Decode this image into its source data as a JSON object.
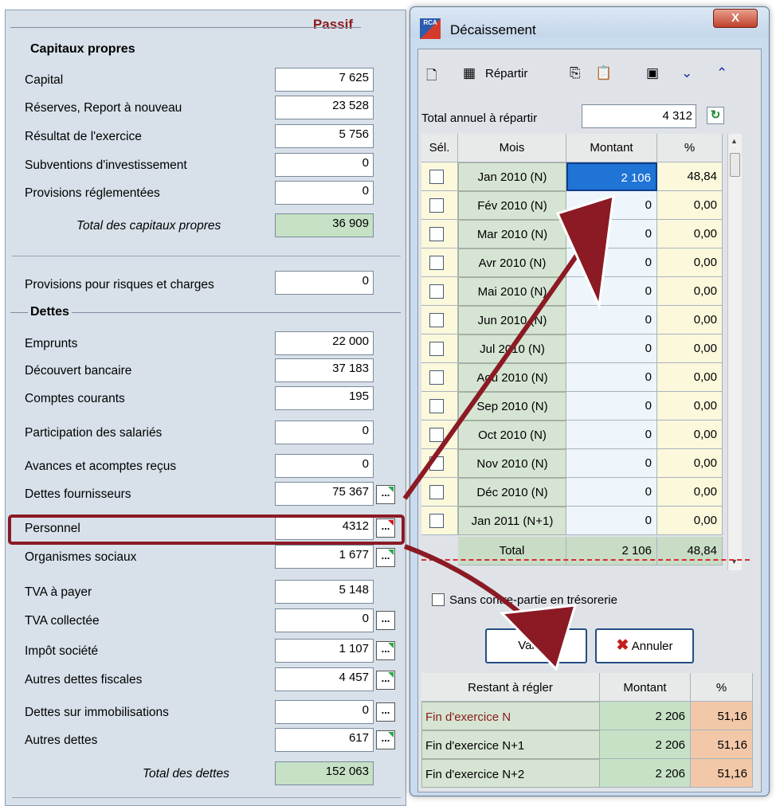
{
  "passif": {
    "title": "Passif",
    "capitaux_label": "Capitaux propres",
    "capitaux": [
      {
        "label": "Capital",
        "value": "7 625"
      },
      {
        "label": "Réserves, Report à nouveau",
        "value": "23 528"
      },
      {
        "label": "Résultat de l'exercice",
        "value": "5 756"
      },
      {
        "label": "Subventions d'investissement",
        "value": "0"
      },
      {
        "label": "Provisions réglementées",
        "value": "0"
      }
    ],
    "total_capitaux": {
      "label": "Total des capitaux propres",
      "value": "36 909"
    },
    "provisions": {
      "label": "Provisions pour risques et charges",
      "value": "0"
    },
    "dettes_label": "Dettes",
    "dettes": [
      {
        "label": "Emprunts",
        "value": "22 000"
      },
      {
        "label": "Découvert bancaire",
        "value": "37 183"
      },
      {
        "label": "Comptes courants",
        "value": "195"
      },
      {
        "label": "Participation des salariés",
        "value": "0"
      },
      {
        "label": "Avances et acomptes reçus",
        "value": "0"
      },
      {
        "label": "Dettes fournisseurs",
        "value": "75 367"
      },
      {
        "label": "Personnel",
        "value": "4312"
      },
      {
        "label": "Organismes sociaux",
        "value": "1 677"
      },
      {
        "label": "TVA à payer",
        "value": "5 148"
      },
      {
        "label": "TVA collectée",
        "value": "0"
      },
      {
        "label": "Impôt société",
        "value": "1 107"
      },
      {
        "label": "Autres dettes fiscales",
        "value": "4 457"
      },
      {
        "label": "Dettes sur immobilisations",
        "value": "0"
      },
      {
        "label": "Autres dettes",
        "value": "617"
      }
    ],
    "total_dettes": {
      "label": "Total des dettes",
      "value": "152 063"
    },
    "dots": "..."
  },
  "dialog": {
    "title": "Décaissement",
    "app_icon_text": "RCA",
    "close": "X",
    "toolbar": {
      "repartir": "Répartir"
    },
    "total_annuel_label": "Total annuel à répartir",
    "total_annuel_value": "4 312",
    "columns": [
      "Sél.",
      "Mois",
      "Montant",
      "%"
    ],
    "rows": [
      {
        "mois": "Jan 2010 (N)",
        "montant": "2 106",
        "pct": "48,84"
      },
      {
        "mois": "Fév 2010 (N)",
        "montant": "0",
        "pct": "0,00"
      },
      {
        "mois": "Mar 2010 (N)",
        "montant": "0",
        "pct": "0,00"
      },
      {
        "mois": "Avr 2010 (N)",
        "montant": "0",
        "pct": "0,00"
      },
      {
        "mois": "Mai 2010 (N)",
        "montant": "0",
        "pct": "0,00"
      },
      {
        "mois": "Jun 2010 (N)",
        "montant": "0",
        "pct": "0,00"
      },
      {
        "mois": "Jul 2010 (N)",
        "montant": "0",
        "pct": "0,00"
      },
      {
        "mois": "Aoû 2010 (N)",
        "montant": "0",
        "pct": "0,00"
      },
      {
        "mois": "Sep 2010 (N)",
        "montant": "0",
        "pct": "0,00"
      },
      {
        "mois": "Oct 2010 (N)",
        "montant": "0",
        "pct": "0,00"
      },
      {
        "mois": "Nov 2010 (N)",
        "montant": "0",
        "pct": "0,00"
      },
      {
        "mois": "Déc 2010 (N)",
        "montant": "0",
        "pct": "0,00"
      },
      {
        "mois": "Jan 2011 (N+1)",
        "montant": "0",
        "pct": "0,00"
      }
    ],
    "total_row": {
      "label": "Total",
      "montant": "2 106",
      "pct": "48,84"
    },
    "sans_contrepartie": "Sans contre-partie en trésorerie",
    "valider": "Valider",
    "annuler": "Annuler",
    "restant": {
      "columns": [
        "Restant à régler",
        "Montant",
        "%"
      ],
      "rows": [
        {
          "label": "Fin d'exercice N",
          "montant": "2 206",
          "pct": "51,16"
        },
        {
          "label": "Fin d'exercice N+1",
          "montant": "2 206",
          "pct": "51,16"
        },
        {
          "label": "Fin d'exercice N+2",
          "montant": "2 206",
          "pct": "51,16"
        }
      ]
    }
  },
  "colors": {
    "accent_red": "#8b1a24",
    "selection_blue": "#1f74d6",
    "green_cell": "#c6e1c6",
    "orange_cell": "#f3c8a8"
  },
  "icons": [
    "new-document-icon",
    "calculator-icon",
    "copy-icon",
    "paste-icon",
    "save-icon",
    "chevron-down-icon",
    "chevron-up-icon",
    "refresh-icon",
    "cancel-x-icon",
    "close-icon"
  ]
}
